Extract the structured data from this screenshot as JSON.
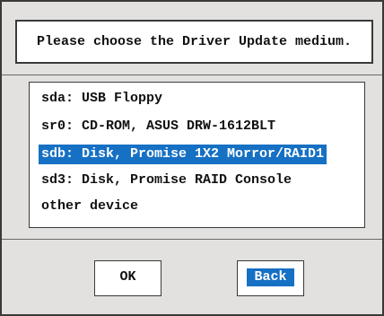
{
  "dialog": {
    "title": "Please choose the Driver Update medium."
  },
  "device_list": {
    "items": [
      {
        "label": "sda: USB Floppy",
        "selected": false
      },
      {
        "label": "sr0: CD-ROM, ASUS DRW-1612BLT",
        "selected": false
      },
      {
        "label": "sdb: Disk, Promise 1X2 Morror/RAID1",
        "selected": true
      },
      {
        "label": "sd3: Disk, Promise RAID Console",
        "selected": false
      },
      {
        "label": "other device",
        "selected": false
      }
    ]
  },
  "buttons": {
    "ok_label": "OK",
    "back_label": "Back",
    "focused": "back"
  },
  "colors": {
    "selection": "#1670c4",
    "dialog_background": "#e2e1df"
  }
}
